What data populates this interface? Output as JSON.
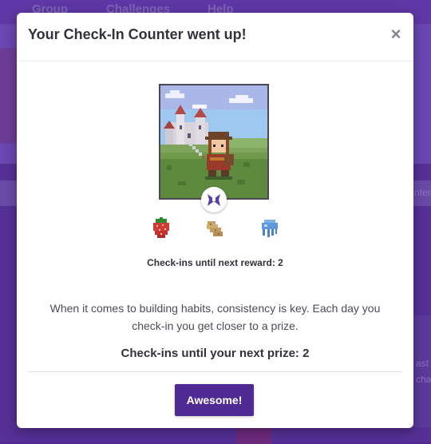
{
  "background": {
    "nav": [
      "Group",
      "Challenges",
      "Help"
    ],
    "fragments": [
      "nter",
      "ast",
      "cha"
    ]
  },
  "modal": {
    "title": "Your Check-In Counter went up!",
    "close_glyph": "×",
    "caption_small": "Check-ins until next reward: 2",
    "body_text": "When it comes to building habits, consistency is key. Each day you check-in you get closer to a prize.",
    "caption_large": "Check-ins until your next prize: 2",
    "cta_label": "Awesome!"
  },
  "rewards": [
    "strawberry-icon",
    "potato-icon",
    "blue-jellyfish-icon"
  ],
  "colors": {
    "brand": "#4f2a93",
    "text_dark": "#34313a",
    "text_body": "#4e4a57"
  }
}
